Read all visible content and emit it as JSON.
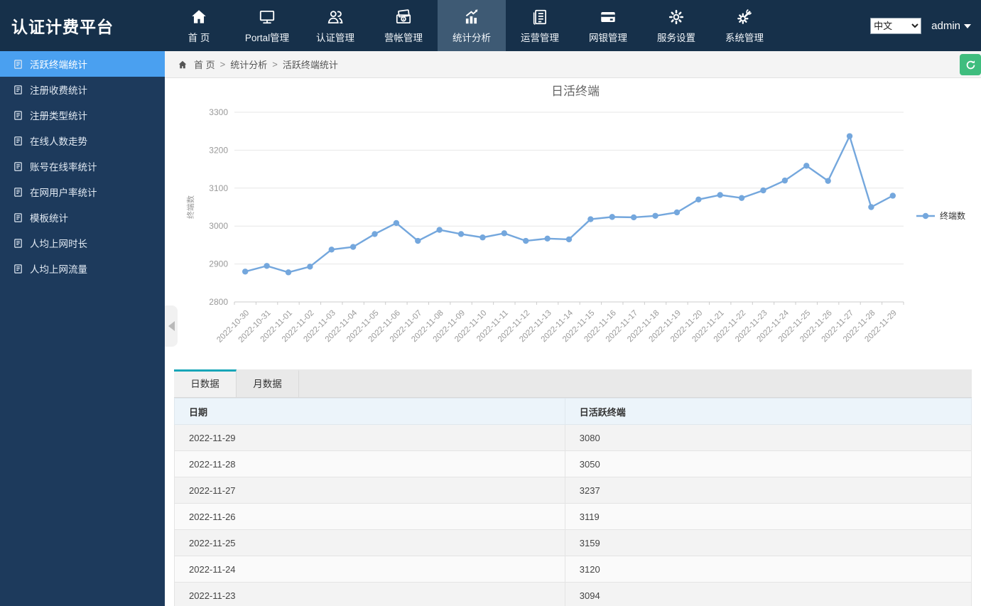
{
  "app": {
    "logo": "认证计费平台"
  },
  "topnav": {
    "items": [
      {
        "label": "首 页",
        "icon": "home",
        "active": false
      },
      {
        "label": "Portal管理",
        "icon": "monitor",
        "active": false
      },
      {
        "label": "认证管理",
        "icon": "users",
        "active": false
      },
      {
        "label": "营帐管理",
        "icon": "billing",
        "active": false
      },
      {
        "label": "统计分析",
        "icon": "chart",
        "active": true
      },
      {
        "label": "运营管理",
        "icon": "operations",
        "active": false
      },
      {
        "label": "网银管理",
        "icon": "bank-card",
        "active": false
      },
      {
        "label": "服务设置",
        "icon": "gear",
        "active": false
      },
      {
        "label": "系统管理",
        "icon": "system-gear",
        "active": false
      }
    ],
    "language": {
      "selected": "中文",
      "options": [
        "中文"
      ]
    },
    "user": "admin"
  },
  "sidebar": {
    "items": [
      {
        "label": "活跃终端统计",
        "active": true
      },
      {
        "label": "注册收费统计",
        "active": false
      },
      {
        "label": "注册类型统计",
        "active": false
      },
      {
        "label": "在线人数走势",
        "active": false
      },
      {
        "label": "账号在线率统计",
        "active": false
      },
      {
        "label": "在网用户率统计",
        "active": false
      },
      {
        "label": "模板统计",
        "active": false
      },
      {
        "label": "人均上网时长",
        "active": false
      },
      {
        "label": "人均上网流量",
        "active": false
      }
    ]
  },
  "breadcrumb": {
    "items": [
      "首 页",
      "统计分析",
      "活跃终端统计"
    ],
    "separator": ">"
  },
  "chart_data": {
    "type": "line",
    "title": "日活终端",
    "xlabel": "",
    "ylabel": "终端数",
    "legend": [
      "终端数"
    ],
    "legend_position": "right",
    "grid": true,
    "ylim": [
      2800,
      3300
    ],
    "ytick_interval": 100,
    "x": [
      "2022-10-30",
      "2022-10-31",
      "2022-11-01",
      "2022-11-02",
      "2022-11-03",
      "2022-11-04",
      "2022-11-05",
      "2022-11-06",
      "2022-11-07",
      "2022-11-08",
      "2022-11-09",
      "2022-11-10",
      "2022-11-11",
      "2022-11-12",
      "2022-11-13",
      "2022-11-14",
      "2022-11-15",
      "2022-11-16",
      "2022-11-17",
      "2022-11-18",
      "2022-11-19",
      "2022-11-20",
      "2022-11-21",
      "2022-11-22",
      "2022-11-23",
      "2022-11-24",
      "2022-11-25",
      "2022-11-26",
      "2022-11-27",
      "2022-11-28",
      "2022-11-29"
    ],
    "series": [
      {
        "name": "终端数",
        "color": "#74a7dd",
        "values": [
          2880,
          2895,
          2878,
          2893,
          2938,
          2945,
          2979,
          3008,
          2961,
          2990,
          2979,
          2970,
          2981,
          2961,
          2967,
          2965,
          3018,
          3024,
          3023,
          3027,
          3036,
          3070,
          3082,
          3074,
          3094,
          3120,
          3159,
          3119,
          3237,
          3050,
          3080
        ]
      }
    ]
  },
  "datatable": {
    "tabs": [
      {
        "label": "日数据",
        "active": true
      },
      {
        "label": "月数据",
        "active": false
      }
    ],
    "columns": [
      "日期",
      "日活跃终端"
    ],
    "rows": [
      [
        "2022-11-29",
        "3080"
      ],
      [
        "2022-11-28",
        "3050"
      ],
      [
        "2022-11-27",
        "3237"
      ],
      [
        "2022-11-26",
        "3119"
      ],
      [
        "2022-11-25",
        "3159"
      ],
      [
        "2022-11-24",
        "3120"
      ],
      [
        "2022-11-23",
        "3094"
      ]
    ]
  },
  "colors": {
    "topbar_bg": "#16304a",
    "topbar_active_bg": "#3e5a74",
    "sidebar_bg": "#1d3a5c",
    "sidebar_active_bg": "#4aa0f0",
    "accent_green": "#3fbd7e",
    "tab_accent": "#18a6b8",
    "chart_line": "#74a7dd",
    "table_header_bg": "#ecf4fa"
  }
}
